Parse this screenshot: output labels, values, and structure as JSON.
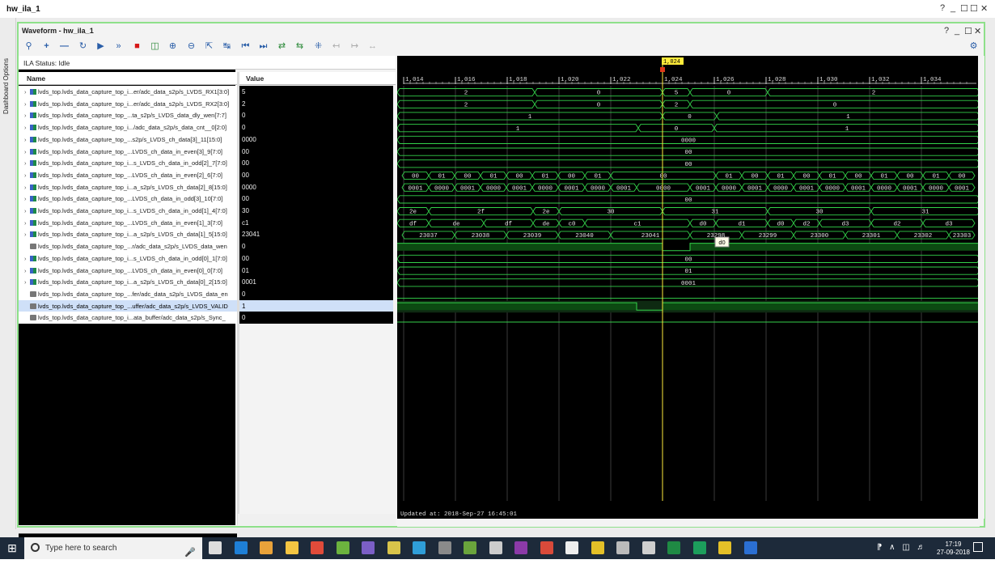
{
  "window": {
    "title": "hw_ila_1",
    "controls": [
      "?",
      "_",
      "☐",
      "☐",
      "✕"
    ]
  },
  "dashboard": {
    "label": "Dashboard Options"
  },
  "waveform": {
    "title": "Waveform - hw_ila_1",
    "controls": [
      "?",
      "_",
      "☐",
      "✕"
    ],
    "status": "ILA Status: Idle",
    "col_name": "Name",
    "col_value": "Value",
    "updated": "Updated at: 2018-Sep-27 16:45:01",
    "cursor_label": "1,024",
    "tooltip": "d0",
    "time_ticks": [
      "1,014",
      "1,016",
      "1,018",
      "1,020",
      "1,022",
      "1,024",
      "1,026",
      "1,028",
      "1,030",
      "1,032",
      "1,034"
    ],
    "toolbar_icons": [
      "search-icon",
      "plus-icon",
      "minus-icon",
      "refresh-icon",
      "run-icon",
      "run-immediate-icon",
      "stop-icon",
      "export-icon",
      "zoom-in-icon",
      "zoom-out-icon",
      "zoom-fit-icon",
      "cursor-icon",
      "go-first-icon",
      "go-last-icon",
      "prev-transition-icon",
      "next-transition-icon",
      "add-marker-icon",
      "prev-marker-icon",
      "next-marker-icon",
      "swap-icon"
    ],
    "signals": [
      {
        "name": "lvds_top.lvds_data_capture_top_i...er/adc_data_s2p/s_LVDS_RX1[3:0]",
        "value": "5",
        "bus": true,
        "segs": [
          [
            "2",
            0,
            170
          ],
          [
            "0",
            170,
            328
          ],
          [
            "5",
            328,
            362
          ],
          [
            "0",
            362,
            458
          ],
          [
            "2",
            458,
            720
          ]
        ]
      },
      {
        "name": "lvds_top.lvds_data_capture_top_i...er/adc_data_s2p/s_LVDS_RX2[3:0]",
        "value": "2",
        "bus": true,
        "segs": [
          [
            "2",
            0,
            170
          ],
          [
            "0",
            170,
            328
          ],
          [
            "2",
            328,
            362
          ],
          [
            "0",
            362,
            720
          ]
        ]
      },
      {
        "name": "lvds_top.lvds_data_capture_top_...ta_s2p/s_LVDS_data_dly_wen[7:7]",
        "value": "0",
        "bus": true,
        "segs": [
          [
            "1",
            0,
            328
          ],
          [
            "0",
            328,
            395
          ],
          [
            "1",
            395,
            720
          ]
        ]
      },
      {
        "name": "lvds_top.lvds_data_capture_top_i.../adc_data_s2p/s_data_cnt__0[2:0]",
        "value": "0",
        "bus": true,
        "segs": [
          [
            "1",
            0,
            298
          ],
          [
            "0",
            298,
            392
          ],
          [
            "1",
            392,
            720
          ]
        ]
      },
      {
        "name": "lvds_top.lvds_data_capture_top_...s2p/s_LVDS_ch_data[3]_11[15:0]",
        "value": "0000",
        "bus": true,
        "segs": [
          [
            "0000",
            0,
            720
          ]
        ]
      },
      {
        "name": "lvds_top.lvds_data_capture_top_...LVDS_ch_data_in_even[3]_9[7:0]",
        "value": "00",
        "bus": true,
        "segs": [
          [
            "00",
            0,
            720
          ]
        ]
      },
      {
        "name": "lvds_top.lvds_data_capture_top_i...s_LVDS_ch_data_in_odd[2]_7[7:0]",
        "value": "00",
        "bus": true,
        "segs": [
          [
            "00",
            0,
            720
          ]
        ]
      },
      {
        "name": "lvds_top.lvds_data_capture_top_...LVDS_ch_data_in_even[2]_6[7:0]",
        "value": "00",
        "bus": true,
        "segs": [
          [
            "00",
            6,
            39
          ],
          [
            "01",
            39,
            71
          ],
          [
            "00",
            71,
            103
          ],
          [
            "01",
            103,
            135
          ],
          [
            "00",
            135,
            167
          ],
          [
            "01",
            167,
            199
          ],
          [
            "00",
            199,
            232
          ],
          [
            "01",
            232,
            264
          ],
          [
            "00",
            264,
            394
          ],
          [
            "01",
            394,
            426
          ],
          [
            "00",
            426,
            458
          ],
          [
            "01",
            458,
            490
          ],
          [
            "00",
            490,
            522
          ],
          [
            "01",
            522,
            554
          ],
          [
            "00",
            554,
            586
          ],
          [
            "01",
            586,
            618
          ],
          [
            "00",
            618,
            650
          ],
          [
            "01",
            650,
            682
          ],
          [
            "00",
            682,
            714
          ]
        ]
      },
      {
        "name": "lvds_top.lvds_data_capture_top_i...a_s2p/s_LVDS_ch_data[2]_8[15:0]",
        "value": "0000",
        "bus": true,
        "segs": [
          [
            "0001",
            6,
            39
          ],
          [
            "0000",
            39,
            71
          ],
          [
            "0001",
            71,
            103
          ],
          [
            "0000",
            103,
            135
          ],
          [
            "0001",
            135,
            167
          ],
          [
            "0000",
            167,
            199
          ],
          [
            "0001",
            199,
            232
          ],
          [
            "0000",
            232,
            264
          ],
          [
            "0001",
            264,
            296
          ],
          [
            "0000",
            296,
            362
          ],
          [
            "0001",
            362,
            394
          ],
          [
            "0000",
            394,
            426
          ],
          [
            "0001",
            426,
            458
          ],
          [
            "0000",
            458,
            490
          ],
          [
            "0001",
            490,
            522
          ],
          [
            "0000",
            522,
            554
          ],
          [
            "0001",
            554,
            586
          ],
          [
            "0000",
            586,
            618
          ],
          [
            "0001",
            618,
            650
          ],
          [
            "0000",
            650,
            682
          ],
          [
            "0001",
            682,
            714
          ]
        ]
      },
      {
        "name": "lvds_top.lvds_data_capture_top_...LVDS_ch_data_in_odd[3]_10[7:0]",
        "value": "00",
        "bus": true,
        "segs": [
          [
            "00",
            0,
            720
          ]
        ]
      },
      {
        "name": "lvds_top.lvds_data_capture_top_i...s_LVDS_ch_data_in_odd[1]_4[7:0]",
        "value": "30",
        "bus": true,
        "segs": [
          [
            "2e",
            0,
            39
          ],
          [
            "2f",
            39,
            168
          ],
          [
            "2e",
            168,
            200
          ],
          [
            "30",
            200,
            328
          ],
          [
            "31",
            328,
            458
          ],
          [
            "30",
            458,
            586
          ],
          [
            "31",
            586,
            720
          ]
        ]
      },
      {
        "name": "lvds_top.lvds_data_capture_top_...LVDS_ch_data_in_even[1]_3[7:0]",
        "value": "c1",
        "bus": true,
        "segs": [
          [
            "df",
            0,
            39
          ],
          [
            "de",
            39,
            107
          ],
          [
            "df",
            107,
            168
          ],
          [
            "de",
            168,
            200
          ],
          [
            "c0",
            200,
            232
          ],
          [
            "c1",
            232,
            362
          ],
          [
            "d0",
            362,
            394
          ],
          [
            "d1",
            394,
            458
          ],
          [
            "d0",
            458,
            490
          ],
          [
            "d2",
            490,
            522
          ],
          [
            "d3",
            522,
            586
          ],
          [
            "d2",
            586,
            650
          ],
          [
            "d3",
            650,
            714
          ]
        ]
      },
      {
        "name": "lvds_top.lvds_data_capture_top_i...a_s2p/s_LVDS_ch_data[1]_5[15:0]",
        "value": "23041",
        "bus": true,
        "segs": [
          [
            "23037",
            6,
            71
          ],
          [
            "23038",
            71,
            135
          ],
          [
            "23039",
            135,
            199
          ],
          [
            "23040",
            199,
            264
          ],
          [
            "23041",
            264,
            362
          ],
          [
            "23298",
            362,
            426
          ],
          [
            "23299",
            426,
            490
          ],
          [
            "23300",
            490,
            554
          ],
          [
            "23301",
            554,
            618
          ],
          [
            "23302",
            618,
            682
          ],
          [
            "23303",
            682,
            714
          ]
        ]
      },
      {
        "name": "lvds_top.lvds_data_capture_top_...r/adc_data_s2p/s_LVDS_data_wen",
        "value": "0",
        "bus": false,
        "bits": [
          [
            1,
            0,
            328
          ],
          [
            0,
            328,
            362
          ],
          [
            1,
            362,
            720
          ]
        ]
      },
      {
        "name": "lvds_top.lvds_data_capture_top_i...s_LVDS_ch_data_in_odd[0]_1[7:0]",
        "value": "00",
        "bus": true,
        "segs": [
          [
            "00",
            0,
            720
          ]
        ]
      },
      {
        "name": "lvds_top.lvds_data_capture_top_...LVDS_ch_data_in_even[0]_0[7:0]",
        "value": "01",
        "bus": true,
        "segs": [
          [
            "01",
            0,
            720
          ]
        ]
      },
      {
        "name": "lvds_top.lvds_data_capture_top_i...a_s2p/s_LVDS_ch_data[0]_2[15:0]",
        "value": "0001",
        "bus": true,
        "segs": [
          [
            "0001",
            0,
            720
          ]
        ]
      },
      {
        "name": "lvds_top.lvds_data_capture_top_...fer/adc_data_s2p/s_LVDS_data_en",
        "value": "0",
        "bus": false,
        "bits": [
          [
            0,
            0,
            720
          ]
        ]
      },
      {
        "name": "lvds_top.lvds_data_capture_top_...uffer/adc_data_s2p/s_LVDS_VALID",
        "value": "1",
        "bus": false,
        "selected": true,
        "bits": [
          [
            1,
            0,
            296
          ],
          [
            0,
            296,
            328
          ],
          [
            1,
            328,
            720
          ]
        ]
      },
      {
        "name": "lvds_top.lvds_data_capture_top_i...ata_buffer/adc_data_s2p/s_Sync_",
        "value": "0",
        "bus": false,
        "bits": [
          [
            0,
            0,
            720
          ]
        ]
      }
    ]
  },
  "taskbar": {
    "search_placeholder": "Type here to search",
    "time": "17:19",
    "date": "27-09-2018",
    "apps": [
      "task-view-icon",
      "edge-icon",
      "store-icon",
      "explorer-icon",
      "chrome-icon",
      "notepadpp-icon",
      "visual-studio-icon",
      "app-icon",
      "notes-icon",
      "obs-icon",
      "app-icon",
      "calculator-icon",
      "app-icon",
      "app-icon",
      "app-icon",
      "vivado-icon",
      "app-icon",
      "photos-icon",
      "excel-icon",
      "hangouts-icon",
      "vivado-icon",
      "docs-icon"
    ]
  },
  "colors": {
    "wave_green": "#33d14a",
    "bus_fill": "#0c4a12",
    "cursor": "#ffeb3b",
    "grid": "#3a3a3a",
    "border": "#8ee08a"
  }
}
